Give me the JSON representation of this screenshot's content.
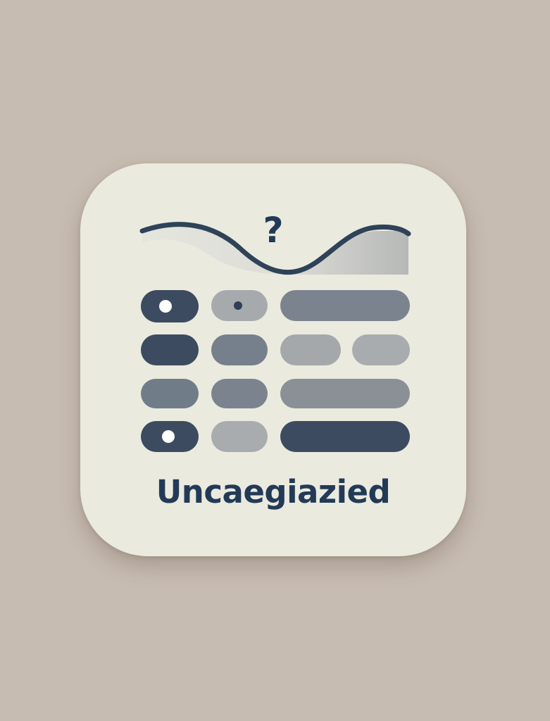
{
  "icon": {
    "label": "Uncaegiazied",
    "question_mark": "?",
    "colors": {
      "background": "#c7bcb1",
      "card": "#eaeadf",
      "dark": "#3d4b60",
      "mid": "#7b838e",
      "light": "#a4a8ab",
      "text": "#233a57"
    }
  }
}
